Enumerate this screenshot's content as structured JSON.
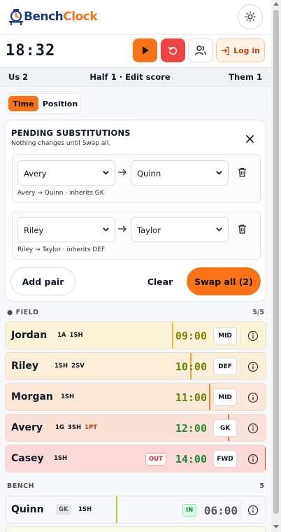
{
  "app": {
    "name_part1": "Bench",
    "name_part2": "Clock"
  },
  "clock": {
    "display": "18:32"
  },
  "toolbar": {
    "login_label": "Log in"
  },
  "score": {
    "us": "Us 2",
    "status": "Half 1 · Edit score",
    "them": "Them 1"
  },
  "mode_toggle": {
    "options": [
      "Time",
      "Position"
    ],
    "selected": "Time"
  },
  "pending": {
    "title": "PENDING SUBSTITUTIONS",
    "subtitle": "Nothing changes until Swap all.",
    "pairs": [
      {
        "out": "Avery",
        "in": "Quinn",
        "note": "Avery → Quinn · inherits GK"
      },
      {
        "out": "Riley",
        "in": "Taylor",
        "note": "Riley → Taylor · inherits DEF"
      }
    ],
    "add_pair_label": "Add pair",
    "clear_label": "Clear",
    "swap_all_label": "Swap all (2)"
  },
  "field": {
    "title": "● FIELD",
    "count": "5/5",
    "players": [
      {
        "name": "Jordan",
        "stats": [
          "1A",
          "1SH"
        ],
        "time": "09:00",
        "position": "MID",
        "bg": "#fcf4d9",
        "bar": "#e6c33a",
        "time_color": "#8a8000"
      },
      {
        "name": "Riley",
        "stats": [
          "1SH",
          "2SV"
        ],
        "time": "10:00",
        "position": "DEF",
        "bg": "#fcefd9",
        "bar": "#f0a43a",
        "time_color": "#6f8500"
      },
      {
        "name": "Morgan",
        "stats": [
          "1SH"
        ],
        "time": "11:00",
        "position": "MID",
        "bg": "#fbe8d9",
        "bar": "#f08a3a",
        "time_color": "#6f8500"
      },
      {
        "name": "Avery",
        "stats": [
          "1G",
          "3SH",
          "1PT"
        ],
        "time": "12:00",
        "position": "GK",
        "bg": "#fbe2d8",
        "bar": "#ee6a3a",
        "time_color": "#2f8a2f"
      },
      {
        "name": "Casey",
        "stats": [
          "1SH"
        ],
        "time": "14:00",
        "position": "FWD",
        "bg": "#fbd9d9",
        "bar": "#ef4444",
        "time_color": "#1f8a3a",
        "badge": "OUT"
      }
    ]
  },
  "bench": {
    "title": "BENCH",
    "count": "5",
    "players": [
      {
        "name": "Quinn",
        "position_badge": "GK",
        "stats": [
          "1SH"
        ],
        "time": "06:00",
        "badge": "IN",
        "bg": "#f2fbe2",
        "bar": "#a3d93a"
      }
    ]
  },
  "colors": {
    "accent": "#f97316",
    "danger": "#ef4444",
    "brand": "#1e3a8a"
  }
}
